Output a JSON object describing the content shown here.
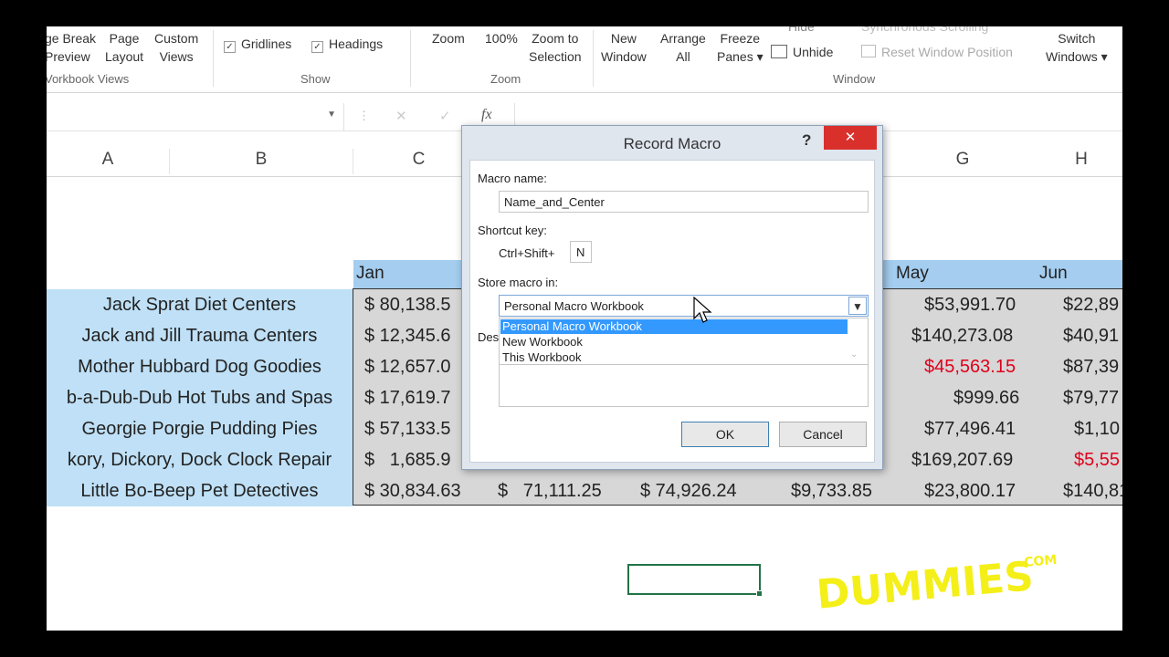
{
  "ribbon": {
    "workbook_views": {
      "page_break": [
        "ge Break",
        "Preview"
      ],
      "page_layout": [
        "Page",
        "Layout"
      ],
      "custom_views": [
        "Custom",
        "Views"
      ],
      "group_label": "Vorkbook Views"
    },
    "show": {
      "gridlines": "Gridlines",
      "headings": "Headings",
      "group_label": "Show"
    },
    "zoom": {
      "zoom": "Zoom",
      "hundred": "100%",
      "zoom_to_selection": [
        "Zoom to",
        "Selection"
      ],
      "group_label": "Zoom"
    },
    "window": {
      "new_window": [
        "New",
        "Window"
      ],
      "arrange_all": [
        "Arrange",
        "All"
      ],
      "freeze_panes": [
        "Freeze",
        "Panes ▾"
      ],
      "hide": "Hide",
      "unhide": "Unhide",
      "sync_scrolling": "Synchronous Scrolling",
      "reset_position": "Reset Window Position",
      "switch_windows": [
        "Switch",
        "Windows ▾"
      ],
      "group_label": "Window"
    }
  },
  "formula_bar": {
    "fx": "fx",
    "cancel": "✕",
    "enter": "✓"
  },
  "columns": [
    "A",
    "B",
    "C",
    "G",
    "H"
  ],
  "months": {
    "c": "Jan",
    "g": "May",
    "h": "Jun"
  },
  "rows": [
    {
      "name": "Jack Sprat Diet Centers",
      "c": "$ 80,138.5",
      "g": "$53,991.70",
      "h": "$22,89"
    },
    {
      "name": "Jack and Jill Trauma Centers",
      "c": "$ 12,345.6",
      "g": "$140,273.08",
      "h": "$40,91"
    },
    {
      "name": "Mother Hubbard Dog Goodies",
      "c": "$ 12,657.0",
      "g": "$45,563.15",
      "h": "$87,39"
    },
    {
      "name": "b-a-Dub-Dub Hot Tubs and Spas",
      "c": "$ 17,619.7",
      "g": "$999.66",
      "h": "$79,77"
    },
    {
      "name": "Georgie Porgie Pudding Pies",
      "c": "$ 57,133.5",
      "g": "$77,496.41",
      "h": "$1,10"
    },
    {
      "name": "kory, Dickory,  Dock Clock Repair",
      "c": "$   1,685.9",
      "g": "$169,207.69",
      "h": "$5,55"
    },
    {
      "name": "Little Bo-Beep Pet Detectives",
      "c": "$ 30,834.63",
      "d": "$   71,111.25",
      "e": "$ 74,926.24",
      "f": "$9,733.85",
      "g": "$23,800.17",
      "h": "$140,81"
    }
  ],
  "dialog": {
    "title": "Record Macro",
    "help": "?",
    "close": "✕",
    "macro_name_label": "Macro name:",
    "macro_name_value": "Name_and_Center",
    "shortcut_label": "Shortcut key:",
    "shortcut_prefix": "Ctrl+Shift+",
    "shortcut_value": "N",
    "store_label": "Store macro in:",
    "store_value": "Personal Macro Workbook",
    "store_options": [
      "Personal Macro Workbook",
      "New Workbook",
      "This Workbook"
    ],
    "description_label_partial": "Des",
    "ok": "OK",
    "cancel": "Cancel"
  },
  "watermark": {
    "text": "DUMMIES",
    "suffix": ".COM"
  },
  "colors": {
    "accent_blue": "#bfe0f6",
    "highlight": "#3399ff",
    "close_red": "#d9302c",
    "watermark": "#f4ef18",
    "selection_green": "#217346"
  }
}
